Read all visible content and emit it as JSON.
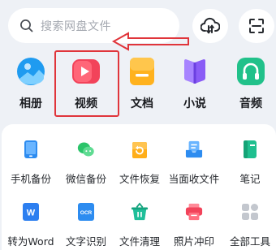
{
  "search": {
    "placeholder": "搜索网盘文件"
  },
  "header_buttons": [
    {
      "name": "cloud-transfer-icon"
    },
    {
      "name": "scan-icon"
    }
  ],
  "categories": [
    {
      "label": "相册",
      "icon": "album-icon",
      "color": "#1f9bf0"
    },
    {
      "label": "视频",
      "icon": "video-icon",
      "color": "#f2435a"
    },
    {
      "label": "文档",
      "icon": "document-icon",
      "color": "#ffb21e"
    },
    {
      "label": "小说",
      "icon": "book-icon",
      "color": "#8a5cf6"
    },
    {
      "label": "音频",
      "icon": "headphones-icon",
      "color": "#21c18a"
    }
  ],
  "annotation": {
    "highlighted": "视频",
    "arrow_color": "#e0353b"
  },
  "tools": [
    {
      "label": "手机备份",
      "icon": "phone-backup-icon",
      "color": "#2d8cf0"
    },
    {
      "label": "微信备份",
      "icon": "wechat-backup-icon",
      "color": "#2bc46a"
    },
    {
      "label": "文件恢复",
      "icon": "file-restore-icon",
      "color": "#ffae1a"
    },
    {
      "label": "当面收文件",
      "icon": "receive-file-icon",
      "color": "#2d8cf0"
    },
    {
      "label": "笔记",
      "icon": "note-icon",
      "color": "#1fbf8f"
    },
    {
      "label": "转为Word",
      "icon": "word-convert-icon",
      "color": "#2d7ff0"
    },
    {
      "label": "文字识别",
      "icon": "ocr-icon",
      "color": "#2d8cf0"
    },
    {
      "label": "文件清理",
      "icon": "file-clean-icon",
      "color": "#1fbf9a"
    },
    {
      "label": "照片冲印",
      "icon": "photo-print-icon",
      "color": "#f2435a"
    },
    {
      "label": "全部工具",
      "icon": "all-tools-icon",
      "color": "#c3c7ce"
    }
  ],
  "tool_badges": {
    "ocr": "OCR",
    "word": "W"
  }
}
